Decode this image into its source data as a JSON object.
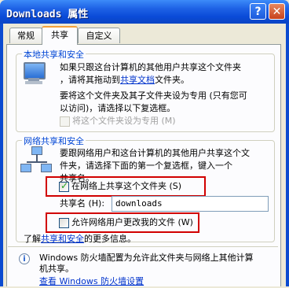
{
  "window": {
    "title": "Downloads 属性",
    "help_label": "?",
    "close_label": "✕"
  },
  "tabs": [
    "常规",
    "共享",
    "自定义"
  ],
  "local": {
    "group_title": "本地共享和安全",
    "line1": "如果只跟这台计算机的其他用户共享这个文件夹",
    "line2_pre": "，请将其拖动到",
    "line2_link": "共享文档",
    "line2_post": "文件夹。",
    "line3": "要将这个文件夹及其子文件夹设为专用 (只有您可",
    "line4": "以访问)，请选择以下复选框。",
    "private_label": "将这个文件夹设为专用 (M)"
  },
  "network": {
    "group_title": "网络共享和安全",
    "line1": "要跟网络用户和这台计算机的其他用户共享这个文",
    "line2": "件夹，请选择下面的第一个复选框，键入一个",
    "line3": "共享名。",
    "share_label": "在网络上共享这个文件夹 (S)",
    "share_checked": true,
    "share_name_label": "共享名 (H):",
    "share_name_value": "downloads",
    "allow_change_label": "允许网络用户更改我的文件 (W)",
    "allow_change_checked": false,
    "learn_more_pre": "了解",
    "learn_more_link": "共享和安全",
    "learn_more_post": "的更多信息。"
  },
  "firewall": {
    "line1": "Windows 防火墙配置为允许此文件夹与网络上其他计算",
    "line2": "机共享。",
    "link": "查看 Windows 防火墙设置"
  }
}
